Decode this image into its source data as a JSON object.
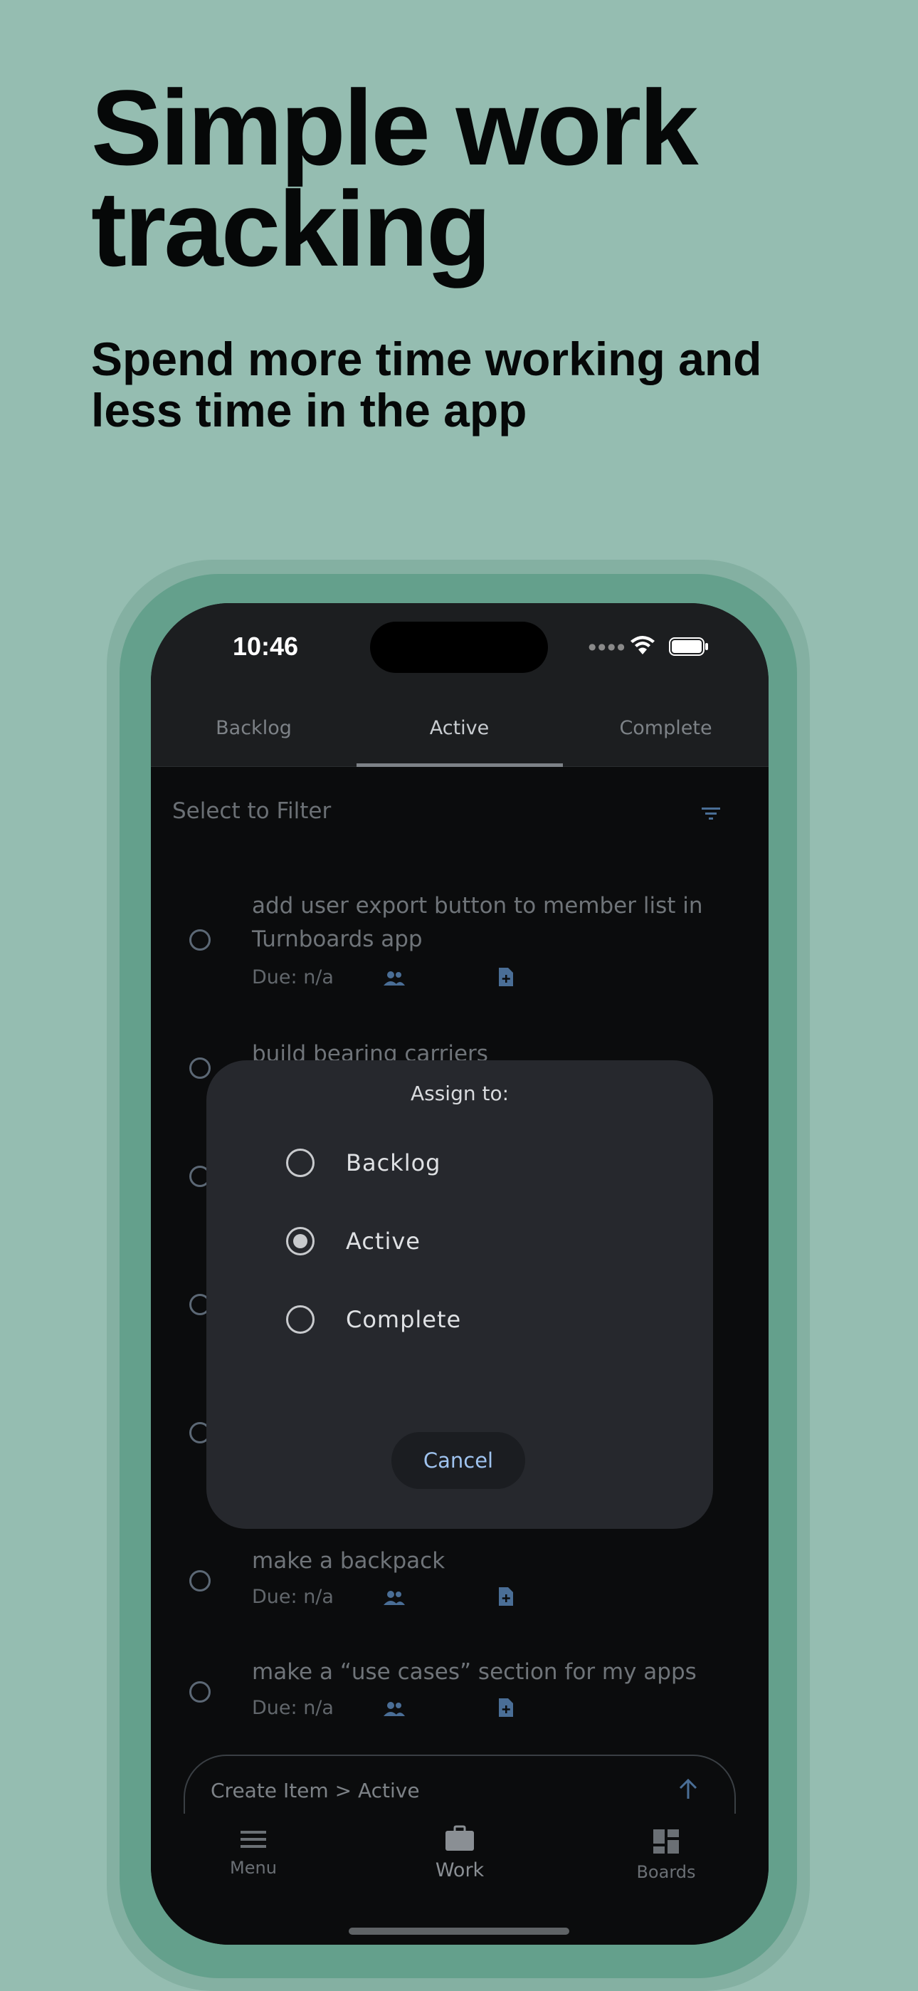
{
  "hero": {
    "title": "Simple work\ntracking",
    "subtitle": "Spend more time working and\nless time in the app"
  },
  "status_bar": {
    "time": "10:46",
    "icons": [
      "cellular-signal-icon",
      "wifi-icon",
      "battery-icon"
    ]
  },
  "tabs": [
    {
      "label": "Backlog",
      "selected": false
    },
    {
      "label": "Active",
      "selected": true
    },
    {
      "label": "Complete",
      "selected": false
    }
  ],
  "filter": {
    "label": "Select to Filter",
    "icon": "filter-icon"
  },
  "items": [
    {
      "title": "add user export button to member list in\nTurnboards  app",
      "due": "Due: n/a"
    },
    {
      "title": "build bearing carriers",
      "due": ""
    },
    {
      "title": "make a backpack",
      "due": "Due: n/a"
    },
    {
      "title": "make a “use cases” section for my apps",
      "due": "Due: n/a"
    }
  ],
  "create_input": {
    "placeholder": "Create Item > Active"
  },
  "bottom_nav": [
    {
      "label": "Menu",
      "icon": "menu-icon",
      "active": false
    },
    {
      "label": "Work",
      "icon": "briefcase-icon",
      "active": true
    },
    {
      "label": "Boards",
      "icon": "dashboard-icon",
      "active": false
    }
  ],
  "dialog": {
    "title": "Assign to:",
    "options": [
      {
        "label": "Backlog",
        "selected": false
      },
      {
        "label": "Active",
        "selected": true
      },
      {
        "label": "Complete",
        "selected": false
      }
    ],
    "cancel_label": "Cancel"
  },
  "colors": {
    "background": "#95bdb1",
    "phone_frame": "#64a08c",
    "screen": "#0b0c0d",
    "dialog": "#26282d",
    "accent_link": "#9fc3ef"
  }
}
